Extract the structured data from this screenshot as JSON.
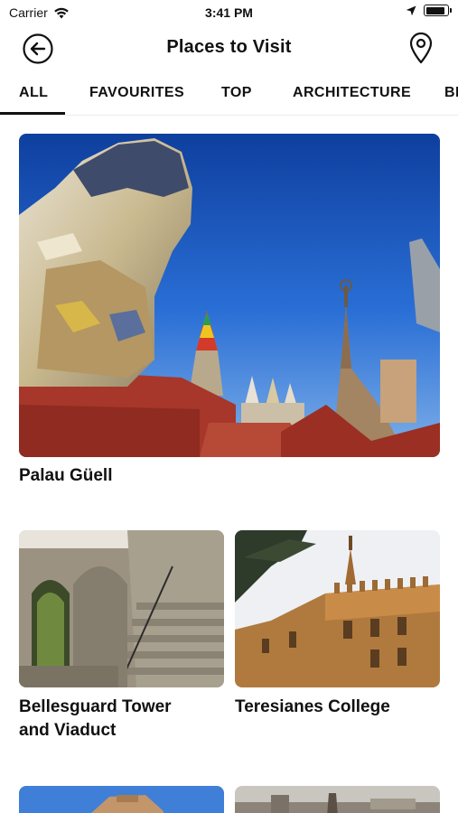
{
  "status_bar": {
    "carrier": "Carrier",
    "time": "3:41 PM",
    "wifi_icon": "wifi-icon",
    "location_icon": "location-arrow-icon",
    "battery_icon": "battery-icon",
    "battery_level": 0.9
  },
  "header": {
    "title": "Places to Visit",
    "back_icon": "back-arrow-icon",
    "map_icon": "map-pin-icon"
  },
  "tabs": {
    "items": [
      {
        "label": "ALL"
      },
      {
        "label": "FAVOURITES"
      },
      {
        "label": "TOP"
      },
      {
        "label": "ARCHITECTURE"
      },
      {
        "label": "BI"
      }
    ],
    "active": "ALL"
  },
  "places": [
    {
      "title": "Palau Güell"
    },
    {
      "title": "Bellesguard Tower\nand Viaduct"
    },
    {
      "title": "Teresianes College"
    },
    {
      "title": ""
    },
    {
      "title": ""
    }
  ],
  "colors": {
    "accent": "#111111",
    "background": "#ffffff",
    "sky": "#1f5fc4"
  }
}
